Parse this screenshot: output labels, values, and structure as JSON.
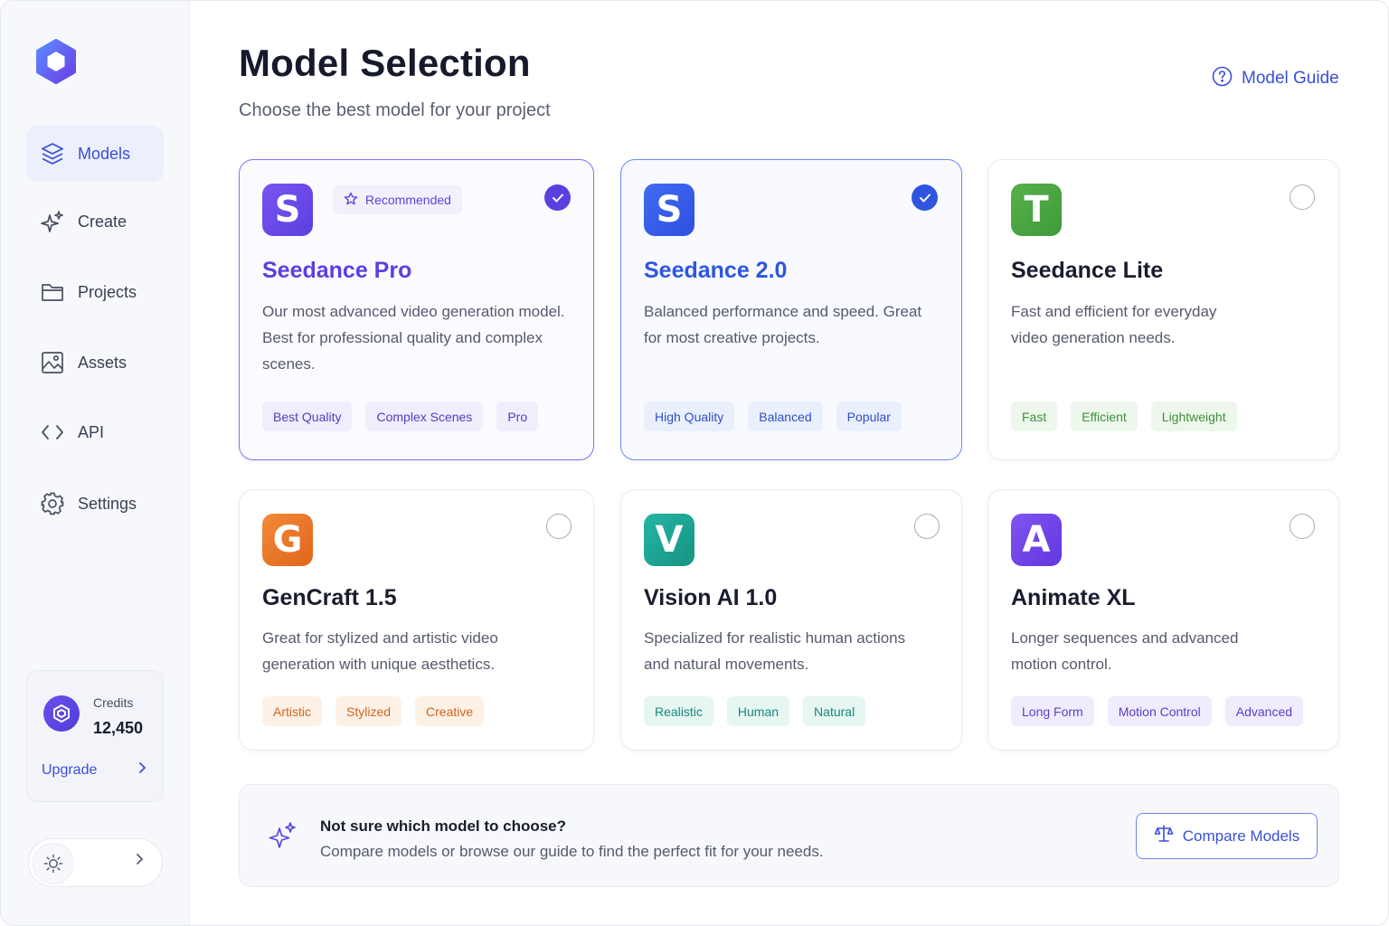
{
  "sidebar": {
    "items": [
      {
        "label": "Models",
        "icon": "layers-icon",
        "active": true
      },
      {
        "label": "Create",
        "icon": "sparkle-icon"
      },
      {
        "label": "Projects",
        "icon": "folder-icon"
      },
      {
        "label": "Assets",
        "icon": "image-icon"
      },
      {
        "label": "API",
        "icon": "code-icon"
      },
      {
        "label": "Settings",
        "icon": "gear-icon"
      }
    ],
    "credits": {
      "label": "Credits",
      "value": "12,450",
      "upgrade_label": "Upgrade"
    },
    "theme_toggle": {
      "icon": "sun-icon"
    }
  },
  "header": {
    "title": "Model Selection",
    "subtitle": "Choose the best model for your project",
    "guide_label": "Model Guide"
  },
  "models": [
    {
      "letter": "S",
      "name": "Seedance Pro",
      "selected": true,
      "recommended": true,
      "recommended_label": "Recommended",
      "description": "Our most advanced video generation model. Best for professional quality and complex scenes.",
      "tags": [
        "Best Quality",
        "Complex Scenes",
        "Pro"
      ],
      "accent": "#5b3fe0"
    },
    {
      "letter": "S",
      "name": "Seedance 2.0",
      "selected": true,
      "description": "Balanced performance and speed. Great for most creative projects.",
      "tags": [
        "High Quality",
        "Balanced",
        "Popular"
      ],
      "accent": "#2f55e0"
    },
    {
      "letter": "T",
      "name": "Seedance Lite",
      "selected": false,
      "description": "Fast and efficient for everyday video generation needs.",
      "tags": [
        "Fast",
        "Efficient",
        "Lightweight"
      ],
      "accent": "#3f9a3a"
    },
    {
      "letter": "G",
      "name": "GenCraft 1.5",
      "selected": false,
      "description": "Great for stylized and artistic video generation with unique aesthetics.",
      "tags": [
        "Artistic",
        "Stylized",
        "Creative"
      ],
      "accent": "#e8731f"
    },
    {
      "letter": "V",
      "name": "Vision AI 1.0",
      "selected": false,
      "description": "Specialized for realistic human actions and natural movements.",
      "tags": [
        "Realistic",
        "Human",
        "Natural"
      ],
      "accent": "#179c8e"
    },
    {
      "letter": "A",
      "name": "Animate XL",
      "selected": false,
      "description": "Longer sequences and advanced motion control.",
      "tags": [
        "Long Form",
        "Motion Control",
        "Advanced"
      ],
      "accent": "#6a3fe0"
    }
  ],
  "help": {
    "title": "Not sure which model to choose?",
    "description": "Compare models or browse our guide to find the perfect fit for your needs.",
    "button_label": "Compare Models"
  }
}
